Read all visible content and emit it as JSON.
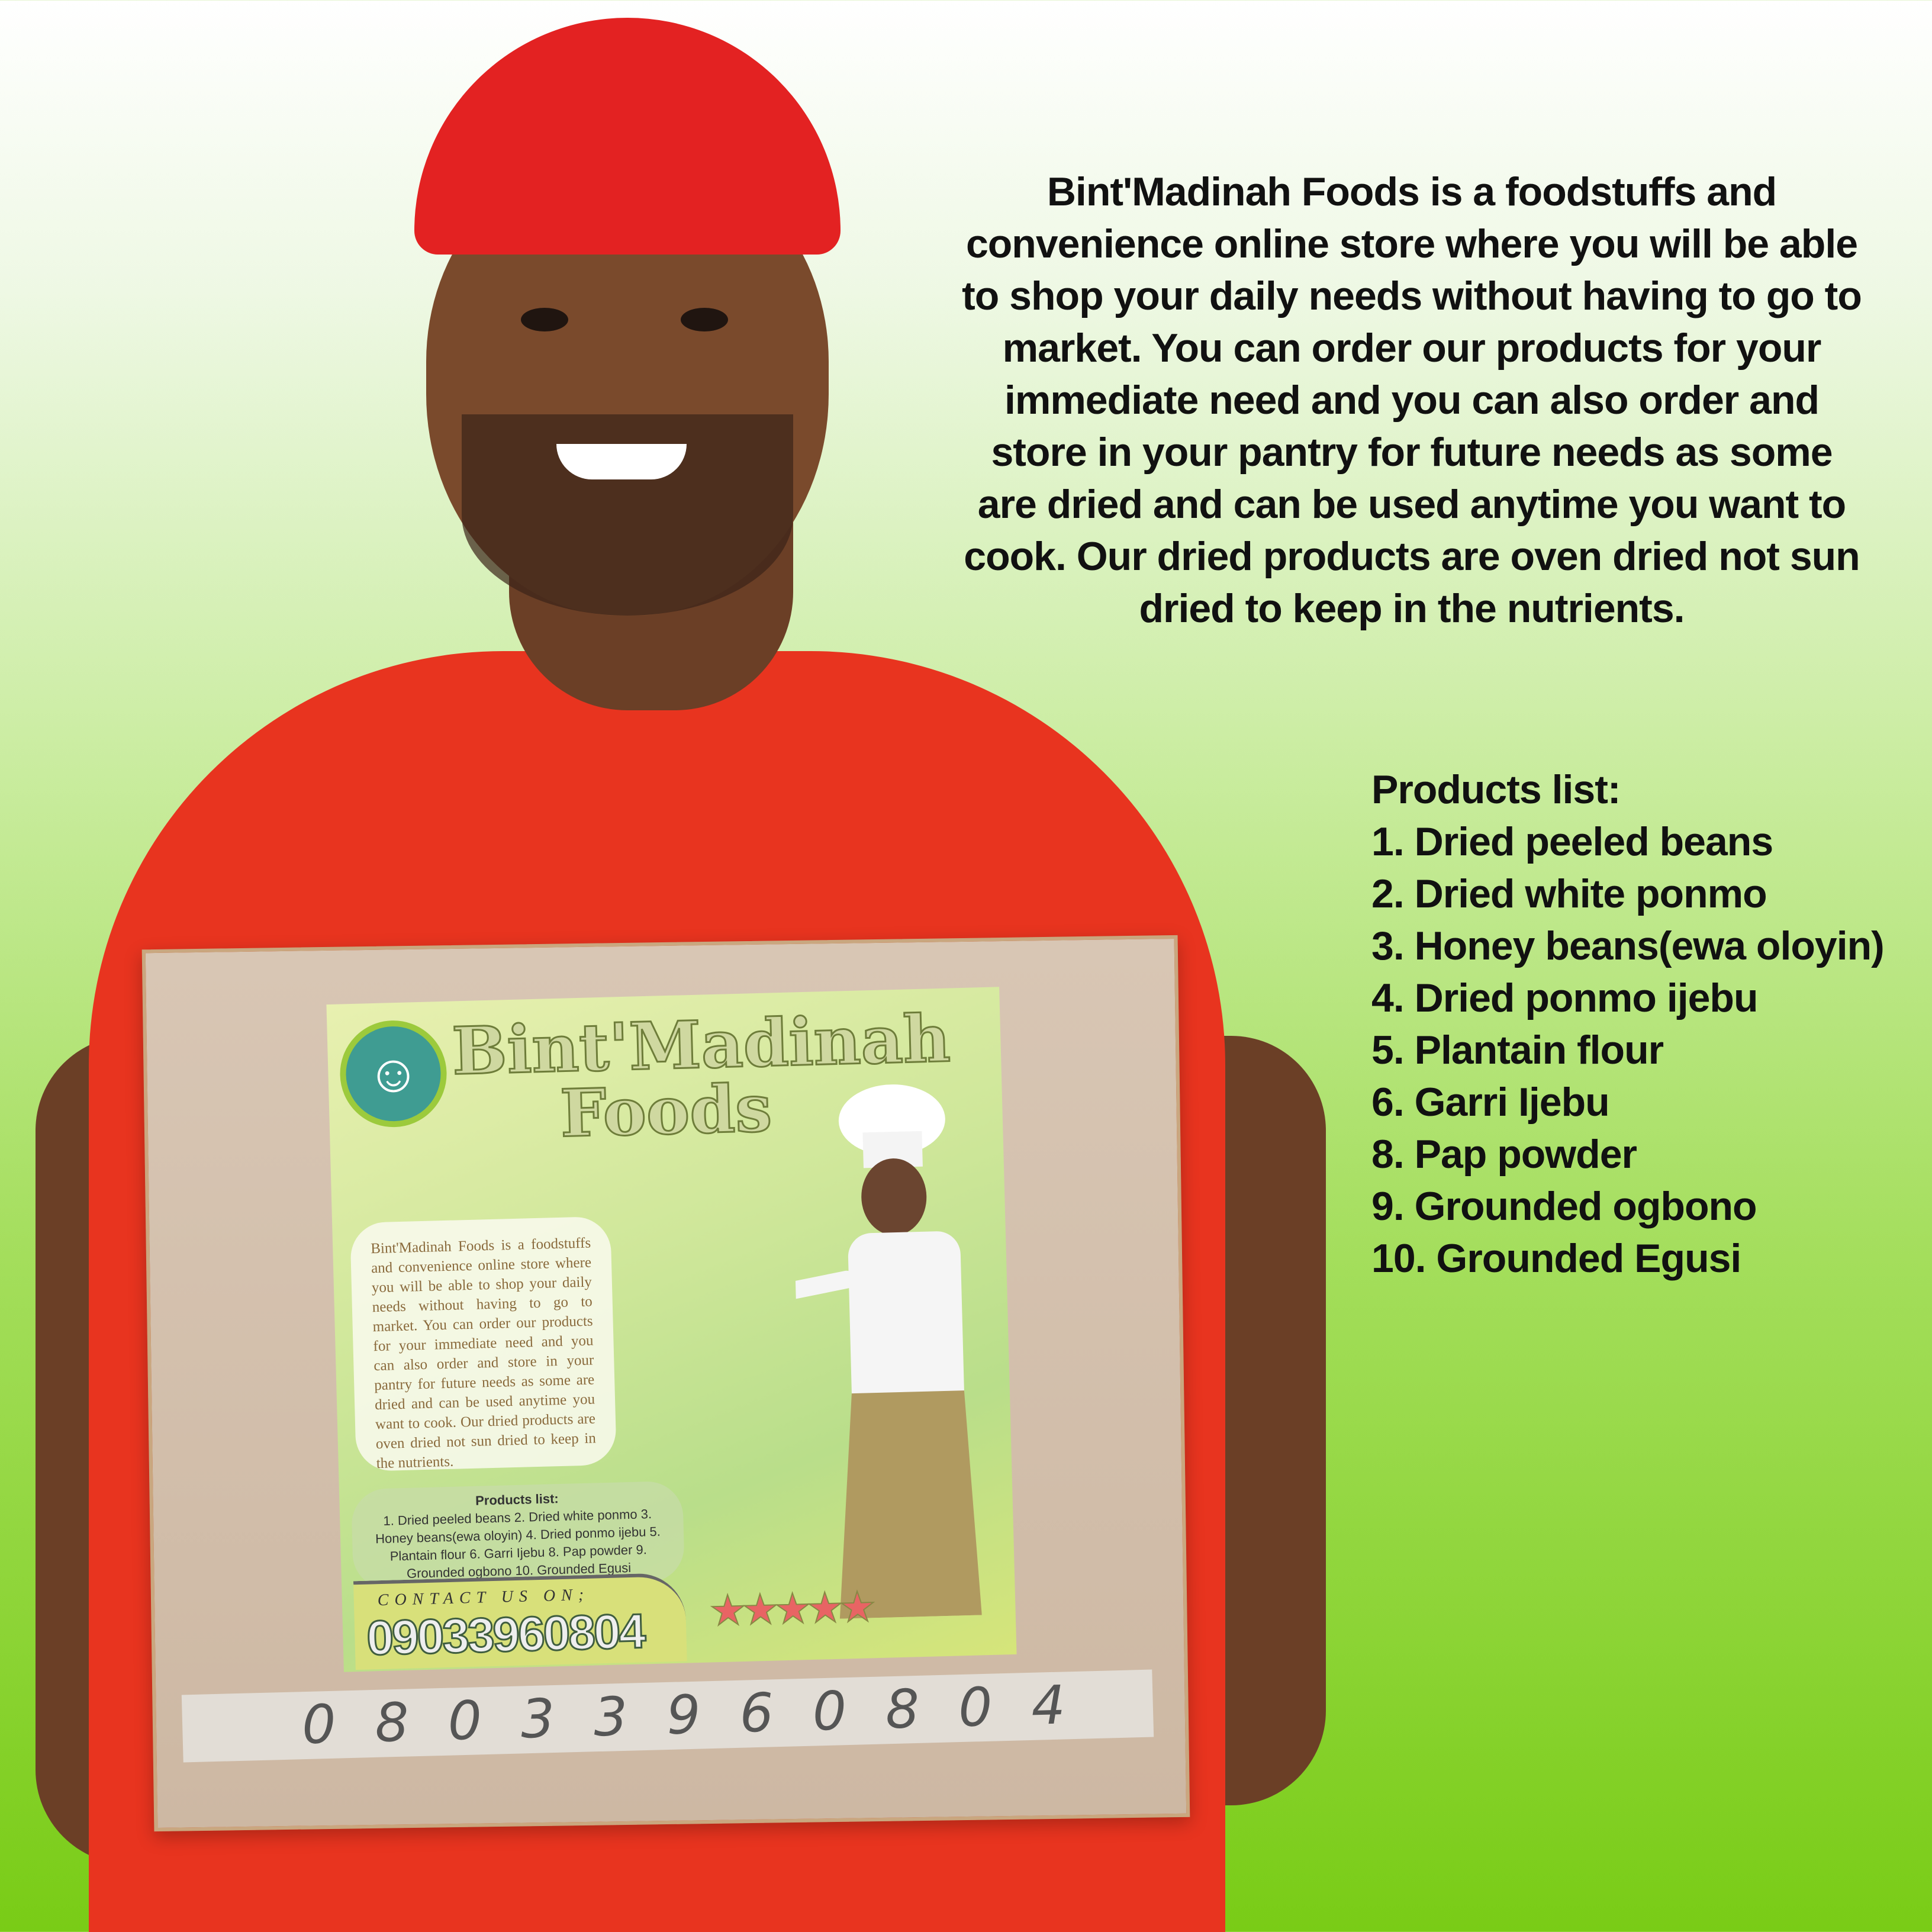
{
  "intro": "Bint'Madinah Foods is a foodstuffs and convenience online store where you will be able to shop your daily needs without having to go to market. You can order our products for your immediate need and you can also order and store in your pantry for future needs as some are dried and can be used anytime you want to cook. Our dried products are oven dried not sun dried to keep in the nutrients.",
  "products": {
    "title": "Products list:",
    "items": [
      "1. Dried peeled beans",
      "2. Dried white ponmo",
      "3. Honey beans(ewa oloyin)",
      "4. Dried ponmo ijebu",
      "5. Plantain flour",
      "6. Garri Ijebu",
      "8. Pap powder",
      "9. Grounded ogbono",
      "10. Grounded Egusi"
    ]
  },
  "flyer": {
    "brand_line1": "Bint'Madinah",
    "brand_line2": "Foods",
    "description": "Bint'Madinah Foods is a foodstuffs and convenience online store where you will be able to shop your daily needs without having to go to market. You can order our products for your immediate need and you can also order and store in your pantry for future needs as some are dried and can be used anytime you want to cook. Our dried products are oven dried not sun dried to keep in the nutrients.",
    "products_title": "Products list:",
    "products_text": "1. Dried peeled beans 2. Dried white ponmo 3. Honey beans(ewa oloyin) 4. Dried ponmo ijebu 5. Plantain flour 6. Garri Ijebu 8. Pap powder 9. Grounded ogbono 10. Grounded Egusi",
    "contact_label": "CONTACT US ON;",
    "phone": "09033960804",
    "rating_stars": 5,
    "stars": "★★★★★"
  },
  "box_tape_number": "08033960804",
  "colors": {
    "shirt": "#e8341f",
    "cap": "#e32222",
    "background_bottom": "#79cc16"
  }
}
